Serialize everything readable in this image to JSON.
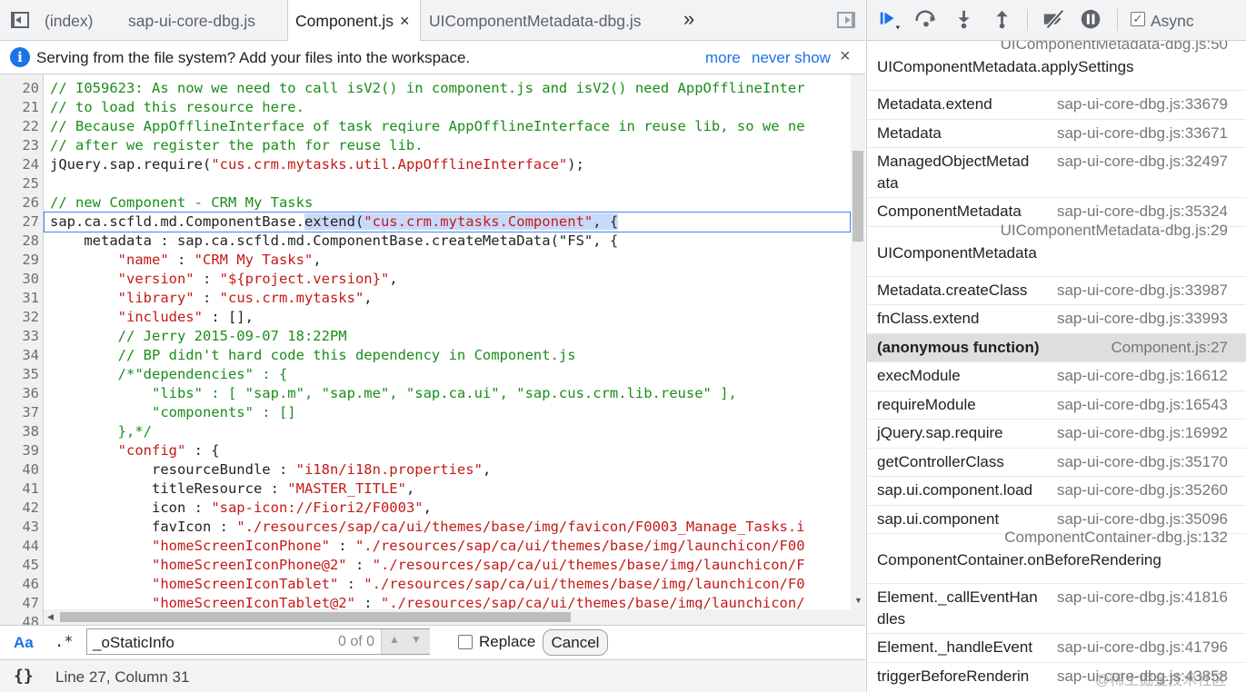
{
  "tabs": [
    {
      "label": "(index)"
    },
    {
      "label": "sap-ui-core-dbg.js"
    },
    {
      "label": "Component.js",
      "close": "×"
    },
    {
      "label": "UIComponentMetadata-dbg.js"
    }
  ],
  "more_tabs": "»",
  "infobar": {
    "text": "Serving from the file system? Add your files into the workspace.",
    "more": "more",
    "never_show": "never show",
    "close": "×",
    "icon": "i"
  },
  "editor": {
    "lines": [
      {
        "n": "20",
        "parts": [
          [
            "c",
            "// I059623: As now we need to call isV2() in component.js and isV2() need AppOfflineInter"
          ]
        ]
      },
      {
        "n": "21",
        "parts": [
          [
            "c",
            "// to load this resource here."
          ]
        ]
      },
      {
        "n": "22",
        "parts": [
          [
            "c",
            "// Because AppOfflineInterface of task reqiure AppOfflineInterface in reuse lib, so we ne"
          ]
        ]
      },
      {
        "n": "23",
        "parts": [
          [
            "c",
            "// after we register the path for reuse lib."
          ]
        ]
      },
      {
        "n": "24",
        "parts": [
          [
            "p",
            "jQuery.sap.require("
          ],
          [
            "s",
            "\"cus.crm.mytasks.util.AppOfflineInterface\""
          ],
          [
            "p",
            ");"
          ]
        ]
      },
      {
        "n": "25",
        "parts": [
          [
            "p",
            ""
          ]
        ]
      },
      {
        "n": "26",
        "parts": [
          [
            "c",
            "// new Component - CRM My Tasks"
          ]
        ]
      },
      {
        "n": "27",
        "parts": [
          [
            "p",
            "sap.ca.scfld.md.ComponentBase."
          ],
          [
            "sel",
            "extend("
          ],
          [
            "sels",
            "\"cus.crm.mytasks.Component\""
          ],
          [
            "sel",
            ", {"
          ]
        ]
      },
      {
        "n": "28",
        "parts": [
          [
            "p",
            "    metadata : sap.ca.scfld.md.ComponentBase.createMetaData(\"FS\", {"
          ]
        ]
      },
      {
        "n": "29",
        "parts": [
          [
            "p",
            "        "
          ],
          [
            "s",
            "\"name\""
          ],
          [
            "p",
            " : "
          ],
          [
            "s",
            "\"CRM My Tasks\""
          ],
          [
            "p",
            ","
          ]
        ]
      },
      {
        "n": "30",
        "parts": [
          [
            "p",
            "        "
          ],
          [
            "s",
            "\"version\""
          ],
          [
            "p",
            " : "
          ],
          [
            "s",
            "\"${project.version}\""
          ],
          [
            "p",
            ","
          ]
        ]
      },
      {
        "n": "31",
        "parts": [
          [
            "p",
            "        "
          ],
          [
            "s",
            "\"library\""
          ],
          [
            "p",
            " : "
          ],
          [
            "s",
            "\"cus.crm.mytasks\""
          ],
          [
            "p",
            ","
          ]
        ]
      },
      {
        "n": "32",
        "parts": [
          [
            "p",
            "        "
          ],
          [
            "s",
            "\"includes\""
          ],
          [
            "p",
            " : [],"
          ]
        ]
      },
      {
        "n": "33",
        "parts": [
          [
            "c",
            "        // Jerry 2015-09-07 18:22PM"
          ]
        ]
      },
      {
        "n": "34",
        "parts": [
          [
            "c",
            "        // BP didn't hard code this dependency in Component.js"
          ]
        ]
      },
      {
        "n": "35",
        "parts": [
          [
            "c",
            "        /*\"dependencies\" : {"
          ]
        ]
      },
      {
        "n": "36",
        "parts": [
          [
            "c",
            "            \"libs\" : [ \"sap.m\", \"sap.me\", \"sap.ca.ui\", \"sap.cus.crm.lib.reuse\" ],"
          ]
        ]
      },
      {
        "n": "37",
        "parts": [
          [
            "c",
            "            \"components\" : []"
          ]
        ]
      },
      {
        "n": "38",
        "parts": [
          [
            "c",
            "        },*/"
          ]
        ]
      },
      {
        "n": "39",
        "parts": [
          [
            "p",
            "        "
          ],
          [
            "s",
            "\"config\""
          ],
          [
            "p",
            " : {"
          ]
        ]
      },
      {
        "n": "40",
        "parts": [
          [
            "p",
            "            resourceBundle : "
          ],
          [
            "s",
            "\"i18n/i18n.properties\""
          ],
          [
            "p",
            ","
          ]
        ]
      },
      {
        "n": "41",
        "parts": [
          [
            "p",
            "            titleResource : "
          ],
          [
            "s",
            "\"MASTER_TITLE\""
          ],
          [
            "p",
            ","
          ]
        ]
      },
      {
        "n": "42",
        "parts": [
          [
            "p",
            "            icon : "
          ],
          [
            "s",
            "\"sap-icon://Fiori2/F0003\""
          ],
          [
            "p",
            ","
          ]
        ]
      },
      {
        "n": "43",
        "parts": [
          [
            "p",
            "            favIcon : "
          ],
          [
            "s",
            "\"./resources/sap/ca/ui/themes/base/img/favicon/F0003_Manage_Tasks.i"
          ]
        ]
      },
      {
        "n": "44",
        "parts": [
          [
            "p",
            "            "
          ],
          [
            "s",
            "\"homeScreenIconPhone\""
          ],
          [
            "p",
            " : "
          ],
          [
            "s",
            "\"./resources/sap/ca/ui/themes/base/img/launchicon/F00"
          ]
        ]
      },
      {
        "n": "45",
        "parts": [
          [
            "p",
            "            "
          ],
          [
            "s",
            "\"homeScreenIconPhone@2\""
          ],
          [
            "p",
            " : "
          ],
          [
            "s",
            "\"./resources/sap/ca/ui/themes/base/img/launchicon/F"
          ]
        ]
      },
      {
        "n": "46",
        "parts": [
          [
            "p",
            "            "
          ],
          [
            "s",
            "\"homeScreenIconTablet\""
          ],
          [
            "p",
            " : "
          ],
          [
            "s",
            "\"./resources/sap/ca/ui/themes/base/img/launchicon/F0"
          ]
        ]
      },
      {
        "n": "47",
        "parts": [
          [
            "p",
            "            "
          ],
          [
            "s",
            "\"homeScreenIconTablet@2\""
          ],
          [
            "p",
            " : "
          ],
          [
            "s",
            "\"./resources/sap/ca/ui/themes/base/img/launchicon/"
          ]
        ]
      },
      {
        "n": "48",
        "parts": [
          [
            "p",
            ""
          ]
        ]
      }
    ]
  },
  "search": {
    "match_case": "Aa",
    "regex": ".*",
    "value": "_oStaticInfo",
    "count": "0 of 0",
    "replace_label": "Replace",
    "cancel_label": "Cancel"
  },
  "status": {
    "pretty_print": "{}",
    "position": "Line 27, Column 31"
  },
  "debugger": {
    "async_label": "Async",
    "async_checked": true
  },
  "call_stack": [
    {
      "fn": "UIComponentMetadata.applySettings",
      "loc": "UIComponentMetadata-dbg.js:50",
      "layout": "stacked"
    },
    {
      "fn": "Metadata.extend",
      "loc": "sap-ui-core-dbg.js:33679"
    },
    {
      "fn": "Metadata",
      "loc": "sap-ui-core-dbg.js:33671"
    },
    {
      "fn": "ManagedObjectMetad",
      "fn2": "ata",
      "loc": "sap-ui-core-dbg.js:32497",
      "layout": "wrap"
    },
    {
      "fn": "ComponentMetadata",
      "loc": "sap-ui-core-dbg.js:35324"
    },
    {
      "fn": "UIComponentMetadata",
      "loc": "UIComponentMetadata-dbg.js:29",
      "layout": "stacked"
    },
    {
      "fn": "Metadata.createClass",
      "loc": "sap-ui-core-dbg.js:33987"
    },
    {
      "fn": "fnClass.extend",
      "loc": "sap-ui-core-dbg.js:33993"
    },
    {
      "fn": "(anonymous function)",
      "loc": "Component.js:27",
      "selected": true
    },
    {
      "fn": "execModule",
      "loc": "sap-ui-core-dbg.js:16612"
    },
    {
      "fn": "requireModule",
      "loc": "sap-ui-core-dbg.js:16543"
    },
    {
      "fn": "jQuery.sap.require",
      "loc": "sap-ui-core-dbg.js:16992"
    },
    {
      "fn": "getControllerClass",
      "loc": "sap-ui-core-dbg.js:35170"
    },
    {
      "fn": "sap.ui.component.load",
      "loc": "sap-ui-core-dbg.js:35260"
    },
    {
      "fn": "sap.ui.component",
      "loc": "sap-ui-core-dbg.js:35096"
    },
    {
      "fn": "ComponentContainer.onBeforeRendering",
      "loc": "ComponentContainer-dbg.js:132",
      "layout": "stacked"
    },
    {
      "fn": "Element._callEventHan",
      "fn2": "dles",
      "loc": "sap-ui-core-dbg.js:41816",
      "layout": "wrap"
    },
    {
      "fn": "Element._handleEvent",
      "loc": "sap-ui-core-dbg.js:41796"
    },
    {
      "fn": "triggerBeforeRenderin",
      "fn2": "g",
      "loc": "sap-ui-core-dbg.js:43858",
      "layout": "wrap"
    }
  ],
  "watermark": "@稀土掘金技术社区",
  "colors": {
    "accent": "#1a73e8",
    "comment": "#1a8d1a",
    "string": "#c41a16",
    "selection": "#c8d9f9"
  }
}
